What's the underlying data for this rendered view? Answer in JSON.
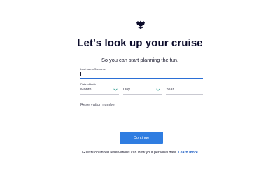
{
  "brand": {
    "logo_icon": "crown-anchor-icon"
  },
  "header": {
    "title": "Let's look up your cruise",
    "subtitle": "So you can start planning the fun."
  },
  "form": {
    "last_name": {
      "label": "Last name/Surname",
      "value": ""
    },
    "dob": {
      "label": "Date of birth",
      "month": "Month",
      "day": "Day",
      "year": "Year"
    },
    "reservation": {
      "placeholder": "Reservation number",
      "value": ""
    },
    "submit_label": "Continue"
  },
  "footer": {
    "text": "Guests on linked reservations can view your personal data.",
    "link": "Learn more"
  },
  "colors": {
    "accent": "#2f7de1",
    "link": "#1f5fc4",
    "active_border": "#2b6fd6"
  }
}
